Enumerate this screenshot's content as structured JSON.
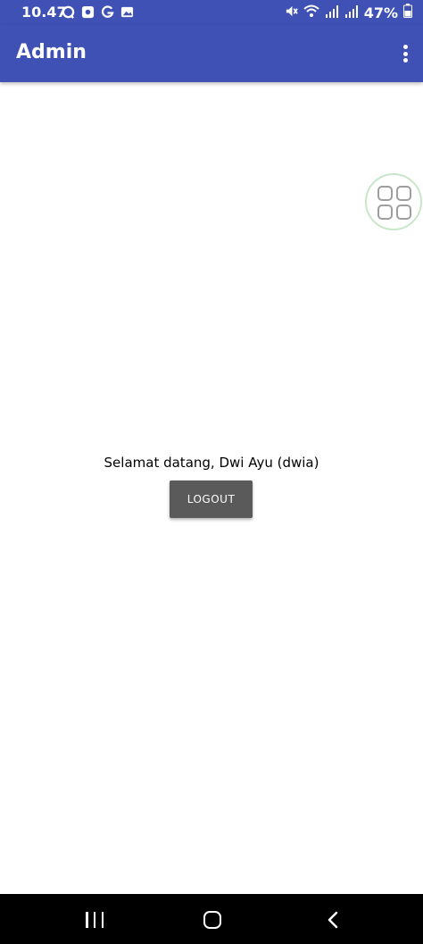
{
  "status_bar": {
    "time": "10.47",
    "left_icons": [
      "whatsapp-icon",
      "notification-icon",
      "google-icon",
      "gallery-icon"
    ],
    "right_icons": [
      "mute-icon",
      "wifi-icon",
      "signal-icon",
      "signal-icon",
      "battery-icon"
    ],
    "battery": "47%"
  },
  "app_bar": {
    "title": "Admin",
    "menu_icon": "overflow-menu-icon"
  },
  "floating_button": {
    "icon": "apps-grid-icon"
  },
  "main": {
    "welcome_text": "Selamat datang, Dwi Ayu (dwia)",
    "logout_label": "LOGOUT"
  },
  "nav_bar": {
    "buttons": [
      "recents-icon",
      "home-icon",
      "back-icon"
    ]
  },
  "colors": {
    "primary": "#3f51b5",
    "button": "#5a5a5a",
    "nav": "#000000"
  }
}
